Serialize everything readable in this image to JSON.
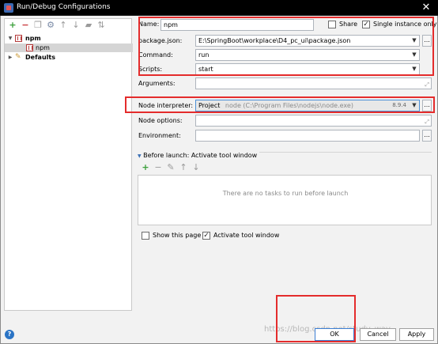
{
  "window": {
    "title": "Run/Debug Configurations"
  },
  "sidebar": {
    "tree": [
      {
        "label": "npm"
      },
      {
        "label": "npm"
      },
      {
        "label": "Defaults"
      }
    ]
  },
  "form": {
    "name_label": "Name:",
    "name_value": "npm",
    "share_label": "Share",
    "single_instance_label": "Single instance only",
    "package_json_label": "package.json:",
    "package_json_value": "E:\\SpringBoot\\workplace\\D4_pc_ui\\package.json",
    "command_label": "Command:",
    "command_value": "run",
    "scripts_label": "Scripts:",
    "scripts_value": "start",
    "arguments_label": "Arguments:",
    "node_interpreter_label": "Node interpreter:",
    "node_interpreter_project": "Project",
    "node_interpreter_path": "node (C:\\Program Files\\nodejs\\node.exe)",
    "node_version": "8.9.4",
    "node_options_label": "Node options:",
    "environment_label": "Environment:"
  },
  "before_launch": {
    "header": "Before launch: Activate tool window",
    "empty_text": "There are no tasks to run before launch"
  },
  "options": {
    "show_this_page": "Show this page",
    "activate_tool_window": "Activate tool window"
  },
  "buttons": {
    "ok": "OK",
    "cancel": "Cancel",
    "apply": "Apply",
    "dots": "..."
  },
  "help": {
    "glyph": "?"
  },
  "watermark": "https://blog.csdn.net/study_way",
  "colors": {
    "accent_blue": "#2a74c5",
    "highlight_red": "#e42c2c",
    "add_green": "#3a9f3a"
  }
}
